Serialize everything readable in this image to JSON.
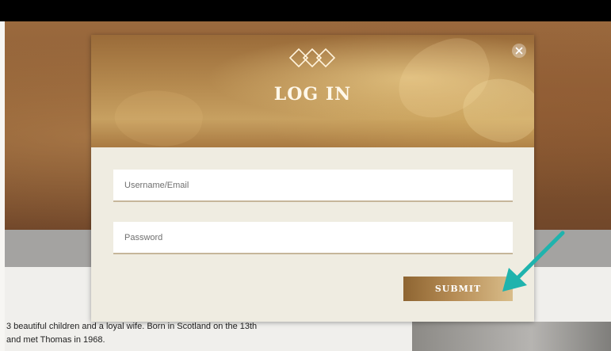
{
  "background": {
    "body_text": [
      "3 beautiful children and a loyal wife. Born in Scotland on the 13th",
      "and met Thomas in 1968."
    ]
  },
  "login_modal": {
    "logo_icon": "interlocking-diamonds-icon",
    "title": "LOG IN",
    "close_icon": "close-icon",
    "username_placeholder": "Username/Email",
    "password_placeholder": "Password",
    "submit_label": "SUBMIT"
  },
  "annotation": {
    "arrow_icon": "arrow-icon",
    "arrow_color": "#1fb3ad"
  },
  "colors": {
    "modal_background": "#efece1",
    "accent_gold": "#b58b54"
  }
}
